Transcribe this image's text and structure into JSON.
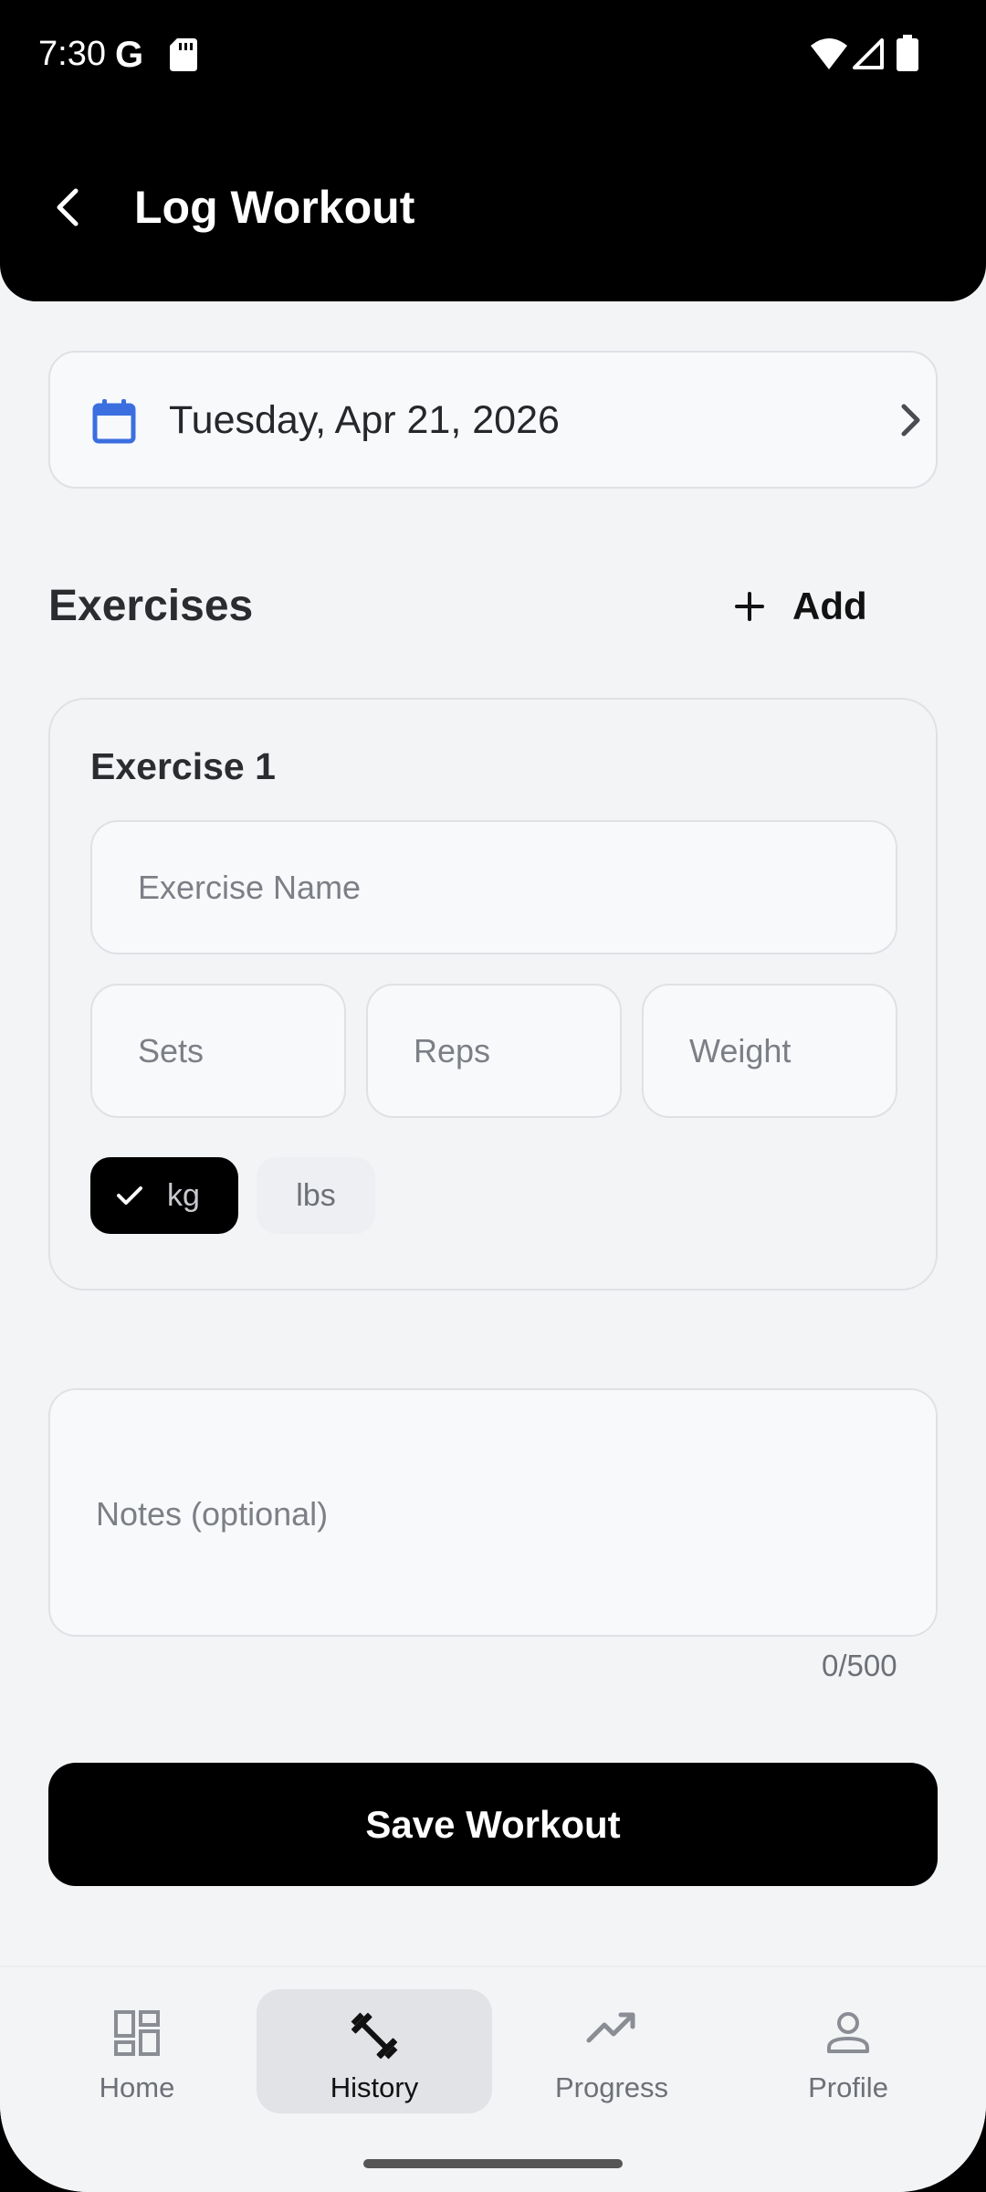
{
  "status_bar": {
    "time": "7:30",
    "g_label": "G"
  },
  "app_bar": {
    "title": "Log Workout"
  },
  "date_card": {
    "date": "Tuesday, Apr 21, 2026"
  },
  "exercises": {
    "title": "Exercises",
    "add_label": "Add",
    "items": [
      {
        "title": "Exercise 1",
        "name_placeholder": "Exercise Name",
        "sets_placeholder": "Sets",
        "reps_placeholder": "Reps",
        "weight_placeholder": "Weight",
        "units": [
          {
            "label": "kg",
            "selected": true
          },
          {
            "label": "lbs",
            "selected": false
          }
        ]
      }
    ]
  },
  "notes": {
    "placeholder": "Notes (optional)",
    "counter": "0/500"
  },
  "save_button": {
    "label": "Save Workout"
  },
  "bottom_nav": {
    "items": [
      {
        "label": "Home",
        "icon": "dashboard-icon",
        "active": false
      },
      {
        "label": "History",
        "icon": "dumbbell-icon",
        "active": true
      },
      {
        "label": "Progress",
        "icon": "trending-up-icon",
        "active": false
      },
      {
        "label": "Profile",
        "icon": "person-icon",
        "active": false
      }
    ]
  },
  "colors": {
    "accent": "#3b6fe0",
    "primary": "#000000",
    "background": "#f3f4f6"
  }
}
